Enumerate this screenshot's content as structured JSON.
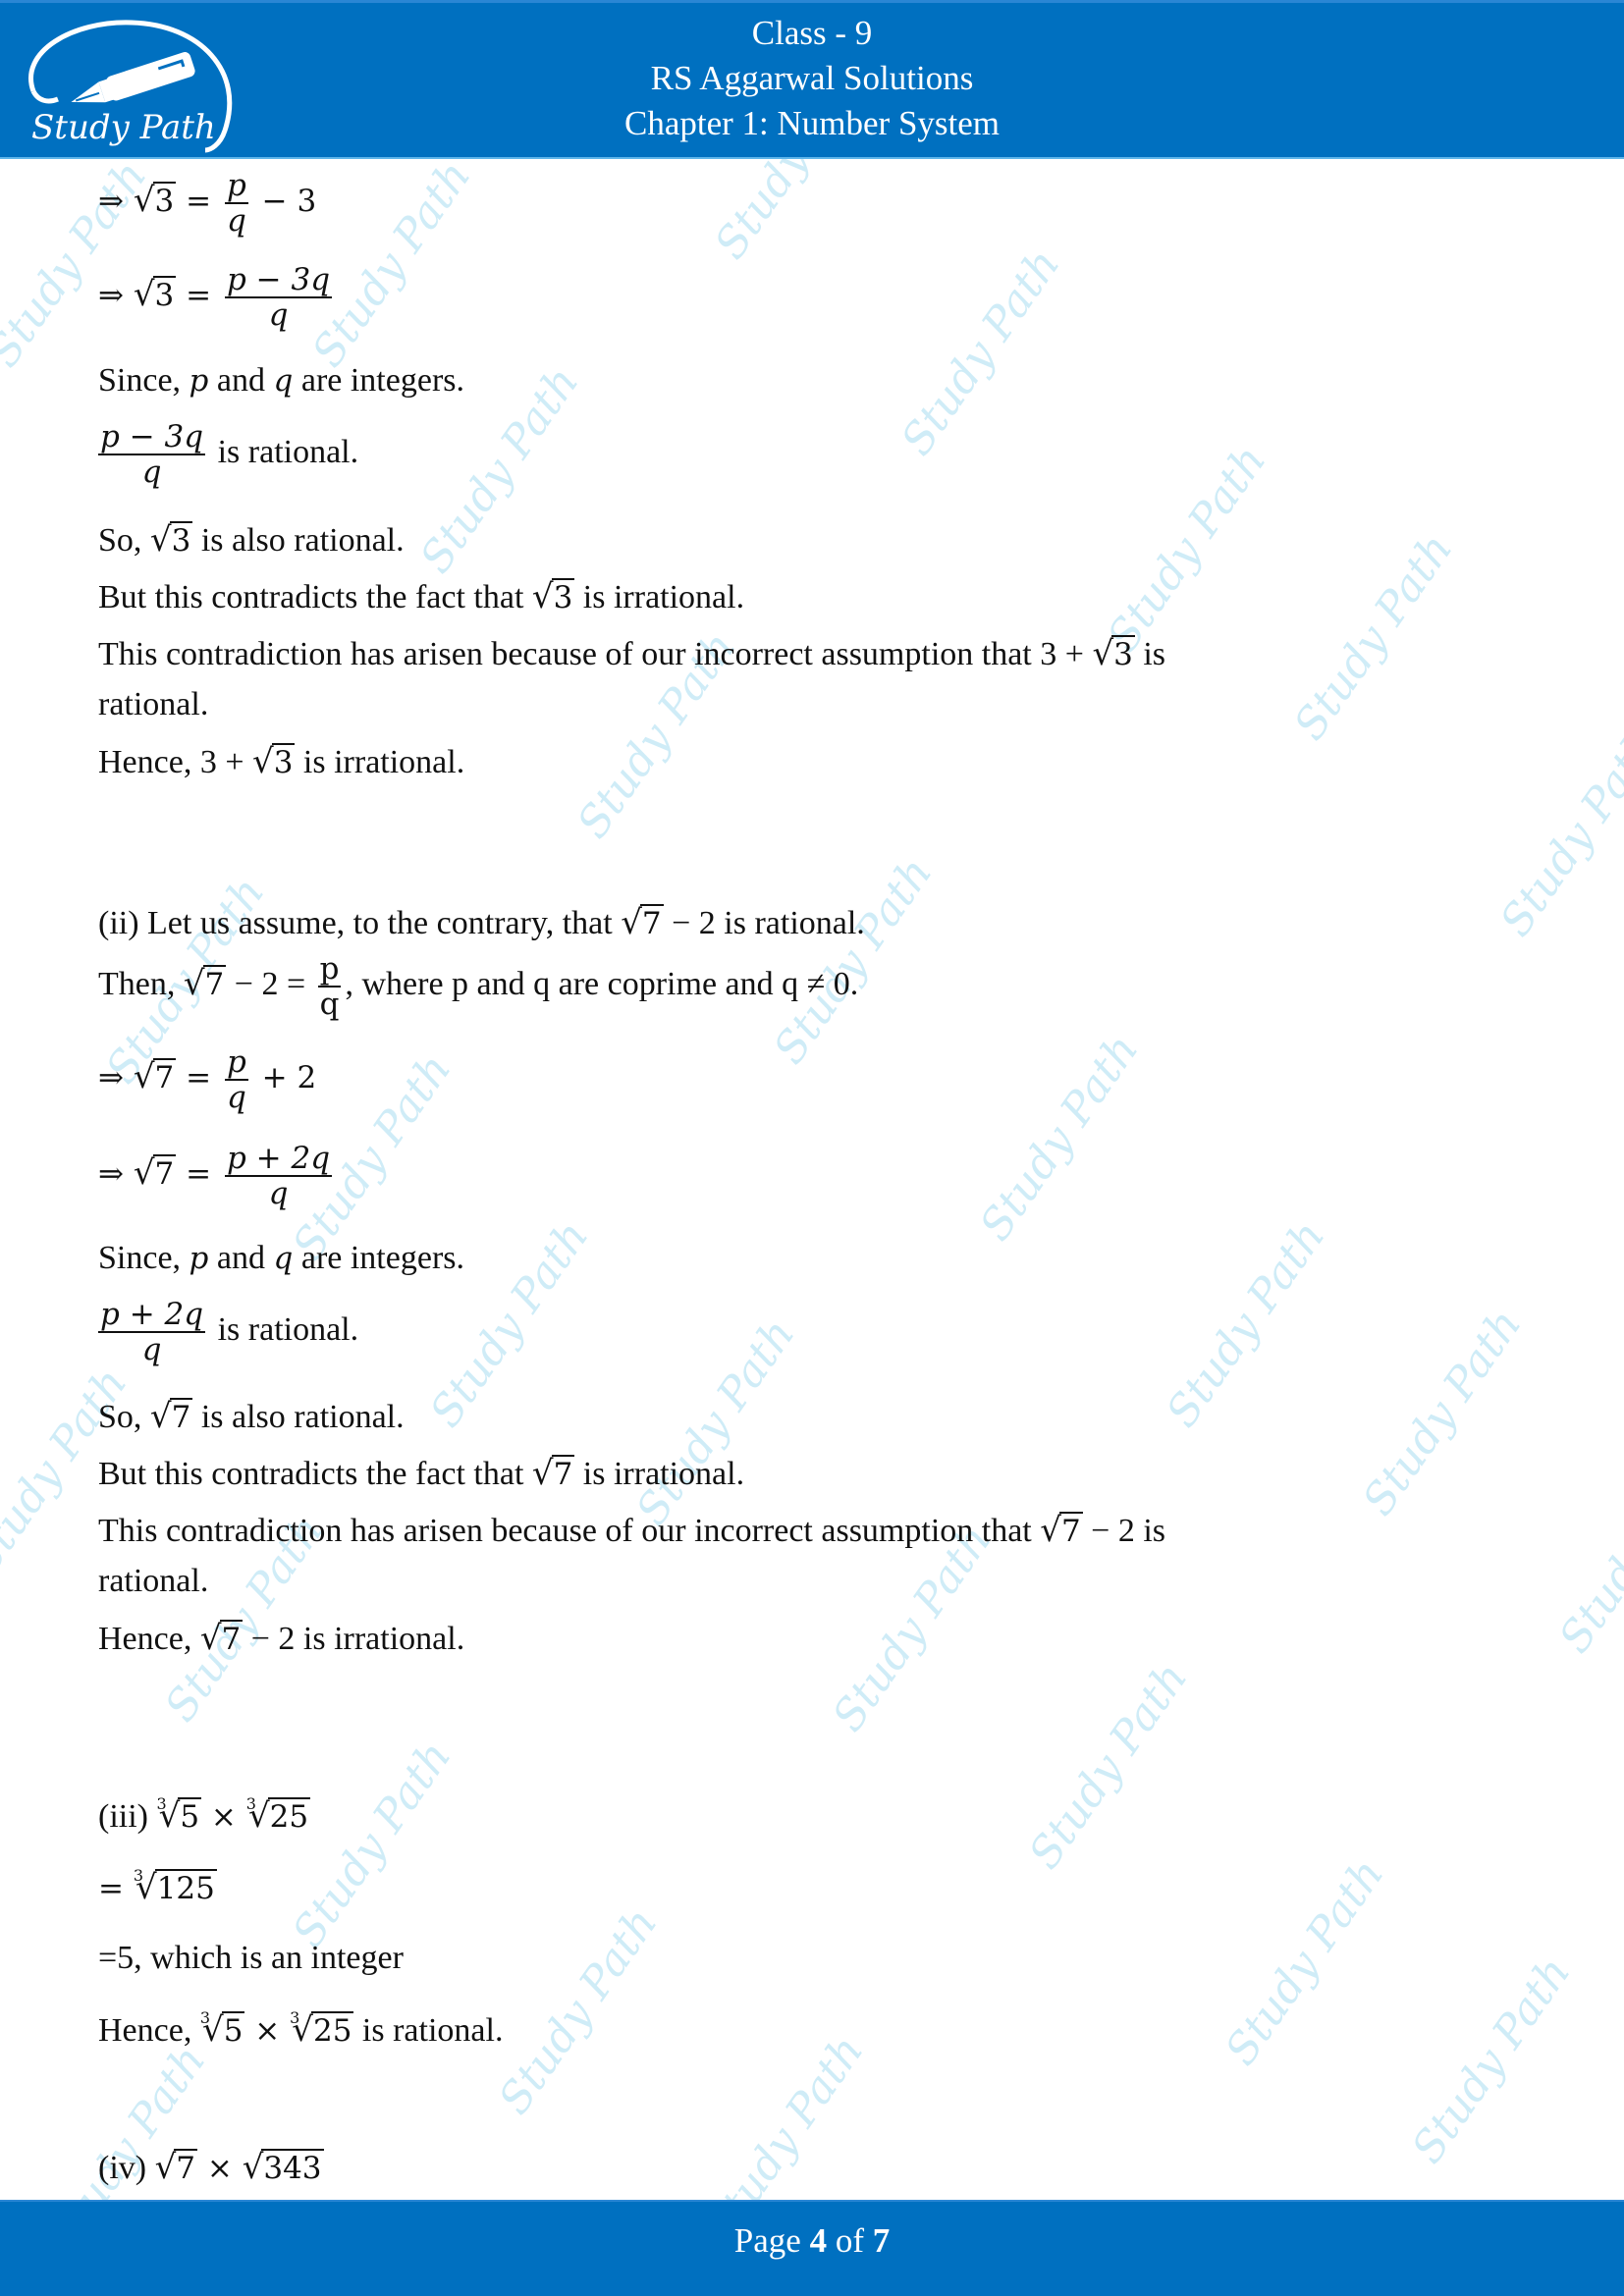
{
  "header": {
    "logo_text": "Study Path",
    "title_line1": "Class - 9",
    "title_line2": "RS Aggarwal Solutions",
    "title_line3": "Chapter 1: Number System",
    "background_color": "#0070c0"
  },
  "watermark": {
    "text": "Study Path",
    "color": "#bfe6f5"
  },
  "part_i": {
    "eq1": {
      "prefix": "⇒ ",
      "radicand": "3",
      "eq": " = ",
      "num": "p",
      "den": "q",
      "suffix": " − 3"
    },
    "eq2": {
      "prefix": "⇒ ",
      "radicand": "3",
      "eq": " = ",
      "num": "p − 3q",
      "den": "q"
    },
    "since": {
      "a": "Since, ",
      "p": "p",
      "b": " and ",
      "q": "q",
      "c": " are integers."
    },
    "rational_frac": {
      "num": "p − 3q",
      "den": "q",
      "text": " is rational."
    },
    "so": {
      "a": "So, ",
      "radicand": "3",
      "b": " is also rational."
    },
    "but": {
      "a": "But this contradicts the fact that ",
      "radicand": "3",
      "b": " is irrational."
    },
    "contradiction": {
      "a": "This contradiction has arisen because of our incorrect assumption that 3 + ",
      "radicand": "3",
      "b": " is",
      "c": "rational."
    },
    "hence": {
      "a": "Hence, 3 + ",
      "radicand": "3",
      "b": " is irrational."
    }
  },
  "part_ii": {
    "assume": {
      "a": "(ii) Let us assume, to the contrary, that ",
      "radicand": "7",
      "b": " − 2 is rational."
    },
    "then": {
      "a": "Then, ",
      "radicand": "7",
      "b": " − 2 = ",
      "num": "p",
      "den": "q",
      "c": ", where p and q are coprime and q ≠ 0."
    },
    "eq1": {
      "prefix": "⇒ ",
      "radicand": "7",
      "eq": " = ",
      "num": "p",
      "den": "q",
      "suffix": " + 2"
    },
    "eq2": {
      "prefix": "⇒ ",
      "radicand": "7",
      "eq": " = ",
      "num": "p + 2q",
      "den": "q"
    },
    "since": {
      "a": "Since, ",
      "p": "p",
      "b": " and ",
      "q": "q",
      "c": " are integers."
    },
    "rational_frac": {
      "num": "p + 2q",
      "den": "q",
      "text": " is rational."
    },
    "so": {
      "a": "So, ",
      "radicand": "7",
      "b": " is also rational."
    },
    "but": {
      "a": "But this contradicts the fact that ",
      "radicand": "7",
      "b": " is irrational."
    },
    "contradiction": {
      "a": "This contradiction has arisen because of our incorrect assumption that ",
      "radicand": "7",
      "b": " − 2 is",
      "c": "rational."
    },
    "hence": {
      "a": "Hence, ",
      "radicand": "7",
      "b": " − 2 is irrational."
    }
  },
  "part_iii": {
    "label": "(iii) ",
    "index": "3",
    "r1": "5",
    "times": " × ",
    "r2": "25",
    "step1_prefix": "= ",
    "step1_radicand": "125",
    "step2": "=5, which is an integer",
    "hence_a": "Hence, ",
    "hence_b": " is rational."
  },
  "part_iv": {
    "label": "(iv) ",
    "r1": "7",
    "times": " × ",
    "r2": "343"
  },
  "footer": {
    "page_label": "Page ",
    "page_current": "4",
    "of_label": " of ",
    "page_total": "7"
  }
}
